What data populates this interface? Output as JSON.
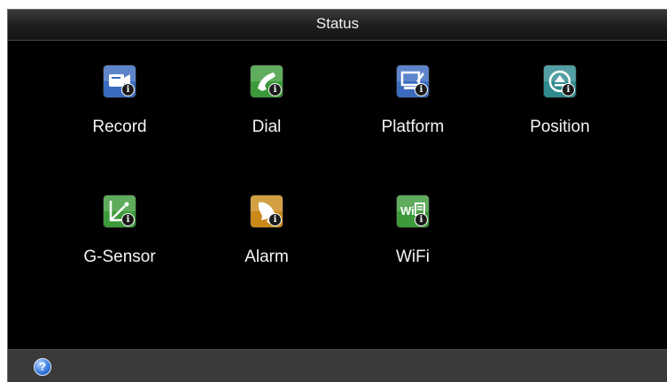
{
  "window": {
    "title": "Status"
  },
  "tiles": [
    {
      "label": "Record",
      "icon": "record-icon",
      "color": "#3b6bbf"
    },
    {
      "label": "Dial",
      "icon": "dial-phone-icon",
      "color": "#3d9a3a"
    },
    {
      "label": "Platform",
      "icon": "platform-icon",
      "color": "#3b6bbf"
    },
    {
      "label": "Position",
      "icon": "position-compass-icon",
      "color": "#2e8a8f"
    },
    {
      "label": "G-Sensor",
      "icon": "g-sensor-icon",
      "color": "#3d9a3a"
    },
    {
      "label": "Alarm",
      "icon": "alarm-bell-icon",
      "color": "#c98a1a"
    },
    {
      "label": "WiFi",
      "icon": "wifi-icon",
      "color": "#3d9a3a",
      "icon_text": "Wi"
    }
  ],
  "badge_text": "i",
  "status_bar": {
    "help_icon": "help-icon",
    "help_text": "?"
  }
}
